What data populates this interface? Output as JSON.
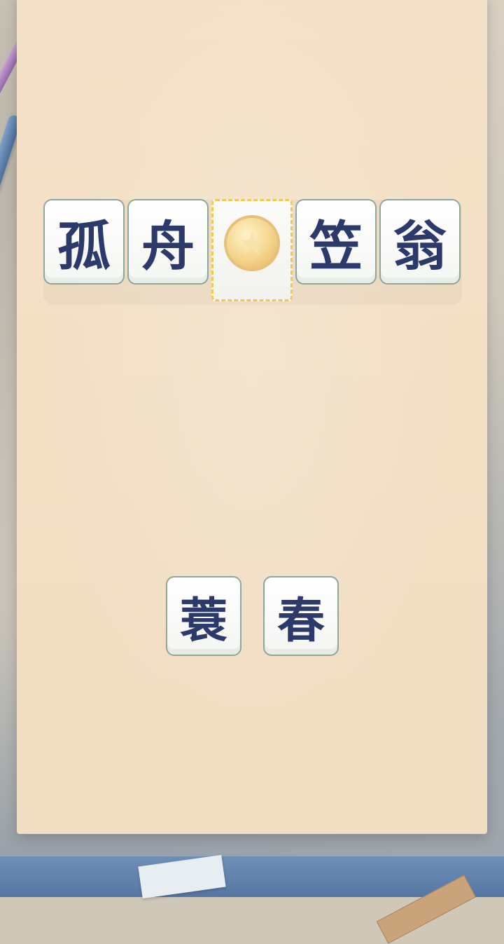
{
  "answer_row": {
    "slots": [
      {
        "char": "孤",
        "filled": true
      },
      {
        "char": "舟",
        "filled": true
      },
      {
        "char": "",
        "filled": false,
        "placeholder_icon": "star-coin-icon"
      },
      {
        "char": "笠",
        "filled": true
      },
      {
        "char": "翁",
        "filled": true
      }
    ]
  },
  "choices": [
    {
      "char": "蓑"
    },
    {
      "char": "春"
    }
  ],
  "colors": {
    "tile_text": "#2b3a6b",
    "tile_base_green": "#4da44a",
    "slot_dashed_yellow": "#f2c94c",
    "paper": "#f2dfc4"
  }
}
